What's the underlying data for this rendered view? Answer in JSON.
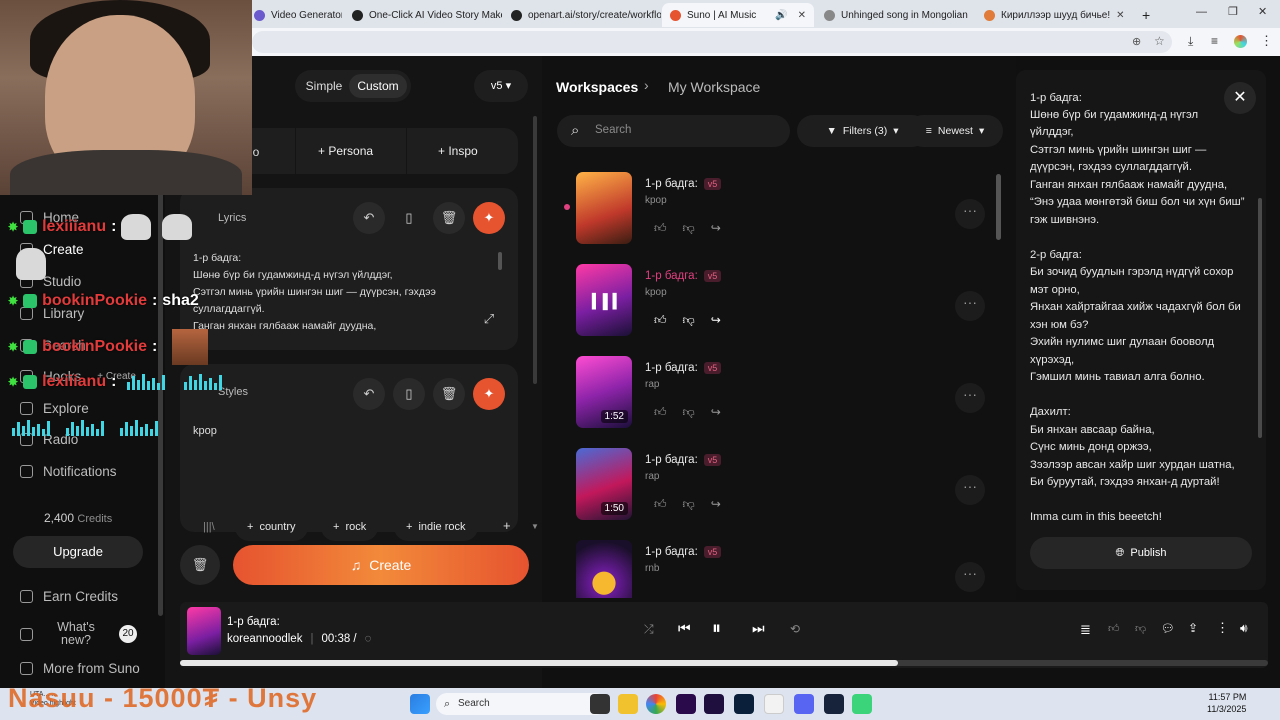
{
  "browser": {
    "tabs": [
      {
        "label": "Video Generator - ",
        "color": "#6a5acd"
      },
      {
        "label": "One-Click AI Video Story Maker",
        "color": "#222222"
      },
      {
        "label": "openart.ai/story/create/workflo",
        "color": "#222222"
      },
      {
        "label": "Suno | AI Music",
        "color": "#e6532f",
        "active": true
      },
      {
        "label": "Unhinged song in Mongolian",
        "color": "#888888"
      },
      {
        "label": "Кириллээр шууд бичье!",
        "color": "#e07b39"
      }
    ],
    "new_tab": "+"
  },
  "sidebar": {
    "items": [
      {
        "label": "Home",
        "icon": "home-icon"
      },
      {
        "label": "Create",
        "icon": "plus-icon"
      },
      {
        "label": "Studio",
        "icon": "studio-icon"
      },
      {
        "label": "Library",
        "icon": "library-icon"
      },
      {
        "label": "Search",
        "icon": "search-icon"
      },
      {
        "label": "Hooks",
        "icon": "hooks-icon"
      },
      {
        "label": "Explore",
        "icon": "compass-icon"
      },
      {
        "label": "Radio",
        "icon": "radio-icon"
      },
      {
        "label": "Notifications",
        "icon": "bell-icon"
      }
    ],
    "hooks_create": "+ Create",
    "credits": "2,400",
    "credits_label": "Credits",
    "upgrade": "Upgrade",
    "earn_credits": "Earn Credits",
    "whats_new": "What's new?",
    "whats_new_count": "20",
    "more_from_suno": "More from Suno"
  },
  "chat": [
    {
      "name": "lexiiianu",
      "message": ""
    },
    {
      "name": "bookinPookie",
      "message": "sha2"
    },
    {
      "name": "bookinPookie",
      "message": ""
    },
    {
      "name": "lexiiianu",
      "message": ""
    }
  ],
  "create_panel": {
    "mode_simple": "Simple",
    "mode_custom": "Custom",
    "version": "v5",
    "tab_audio": "io",
    "tab_persona": "Persona",
    "tab_inspo": "Inspo",
    "lyrics_label": "Lyrics",
    "lyrics_lines": [
      "1-р бадга:",
      "Шөнө бүр би гудамжинд-д нүгэл үйлддэг,",
      "Сэтгэл минь үрийн шингэн шиг — дүүрсэн, гэхдээ",
      "суллагддаггүй.",
      "Ганган янхан гялбааж намайг дуудна,"
    ],
    "styles_label": "Styles",
    "styles_value": "kpop",
    "style_tags": [
      "country",
      "rock",
      "indie rock"
    ],
    "create_button": "Create"
  },
  "workspace": {
    "breadcrumb_root": "Workspaces",
    "breadcrumb_current": "My Workspace",
    "search_placeholder": "Search",
    "filters": "Filters (3)",
    "sort": "Newest",
    "songs": [
      {
        "title": "1-р бадга:",
        "version": "v5",
        "genre": "kpop",
        "duration": "",
        "highlight": false
      },
      {
        "title": "1-р бадга:",
        "version": "v5",
        "genre": "kpop",
        "duration": "",
        "highlight": true
      },
      {
        "title": "1-р бадга:",
        "version": "v5",
        "genre": "rap",
        "duration": "1:52",
        "highlight": false
      },
      {
        "title": "1-р бадга:",
        "version": "v5",
        "genre": "rap",
        "duration": "1:50",
        "highlight": false
      },
      {
        "title": "1-р бадга:",
        "version": "v5",
        "genre": "rnb",
        "duration": "",
        "highlight": false
      }
    ]
  },
  "detail": {
    "lyrics": [
      "1-р бадга:",
      "Шөнө бүр би гудамжинд-д нүгэл",
      "үйлддэг,",
      "Сэтгэл минь үрийн шингэн шиг —",
      "дүүрсэн, гэхдээ суллагддаггүй.",
      "Ганган янхан гялбааж намайг дуудна,",
      "“Энэ удаа мөнгөтэй биш бол чи хүн биш”",
      "гэж шивнэнэ.",
      "",
      "2-р бадга:",
      "Би зочид буудлын гэрэлд нүдгүй сохор",
      "мэт орно,",
      "Янхан хайртайгаа хийж чадахгүй бол би",
      "хэн юм бэ?",
      "Эхийн нулимс шиг дулаан бооволд",
      "хүрэхэд,",
      "Гэмшил минь тавиал алга болно.",
      "",
      "Дахилт:",
      "Би янхан авсаар байна,",
      "Сүнс минь донд оржээ,",
      "Зээлээр авсан хайр шиг хурдан шатна,",
      "Би буруутай, гэхдээ янхан-д дуртай!",
      "",
      "Imma cum in this beeetch!"
    ],
    "publish": "Publish"
  },
  "player": {
    "title": "1-р бадга:",
    "artist": "koreannoodlek",
    "time": "00:38 /",
    "progress": 0.66
  },
  "overlay_bottom": "Nasuu - 15000₮ - Unsy",
  "taskbar": {
    "search": "Search",
    "time": "11:57 PM",
    "date": "11/3/2025",
    "weather": "UTA... ...",
    "weather_sub": "Video highlight"
  }
}
